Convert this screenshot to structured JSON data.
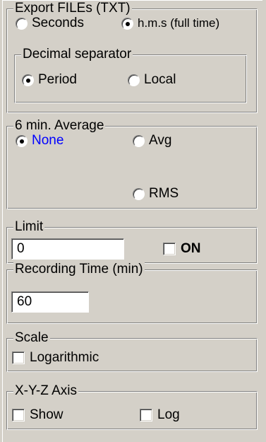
{
  "export_files": {
    "title": "Export FILEs (TXT)",
    "seconds_label": "Seconds",
    "hms_label": "h.m.s (full time)",
    "selected": "h.m.s (full time)",
    "decimal_separator": {
      "title": "Decimal separator",
      "period_label": "Period",
      "local_label": "Local",
      "selected": "Period"
    }
  },
  "six_min_average": {
    "title": "6 min. Average",
    "none_label": "None",
    "avg_label": "Avg",
    "rms_label": "RMS",
    "selected": "None",
    "highlight_color": "#0000ff"
  },
  "limit": {
    "title": "Limit",
    "value": "0",
    "on_label": "ON",
    "on_checked": false
  },
  "recording_time": {
    "title": "Recording Time (min)",
    "value": "60"
  },
  "scale": {
    "title": "Scale",
    "logarithmic_label": "Logarithmic",
    "logarithmic_checked": false
  },
  "xyz_axis": {
    "title": "X-Y-Z Axis",
    "show_label": "Show",
    "log_label": "Log",
    "show_checked": false,
    "log_checked": false
  }
}
